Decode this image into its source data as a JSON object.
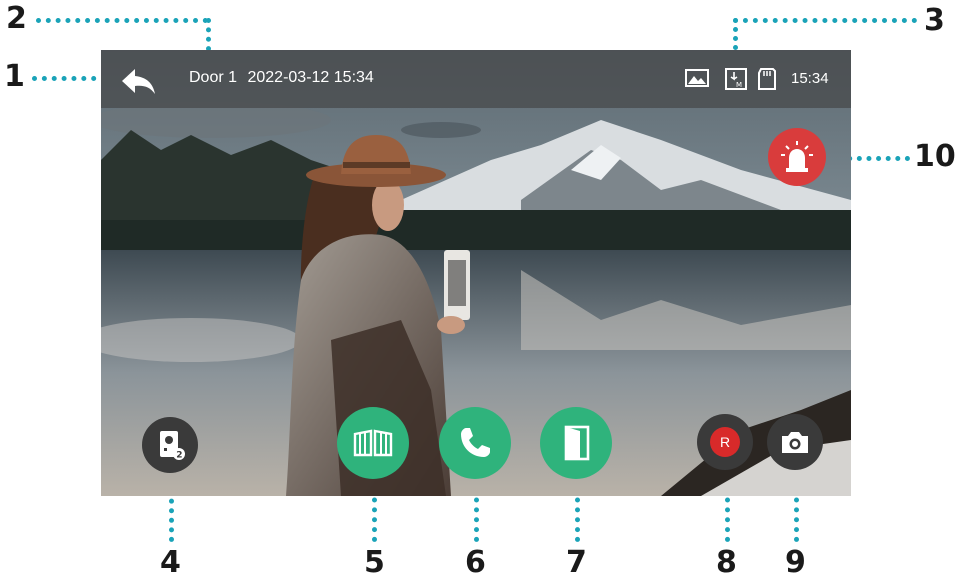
{
  "top_bar": {
    "door_label": "Door 1",
    "datetime": "2022-03-12 15:34",
    "time": "15:34",
    "status_icons": [
      "image-icon",
      "motion-icon",
      "sd-card-icon"
    ]
  },
  "buttons": {
    "back": "back-arrow-icon",
    "monitor_switch": "door-station-2-icon",
    "gate": "gate-icon",
    "call": "phone-icon",
    "door": "door-icon",
    "record_label": "R",
    "snapshot": "camera-icon",
    "alarm": "alarm-icon"
  },
  "callouts": [
    "1",
    "2",
    "3",
    "4",
    "5",
    "6",
    "7",
    "8",
    "9",
    "10"
  ],
  "colors": {
    "callout_line": "#1aa3b8",
    "green_button": "#2fb37c",
    "dark_button": "#3a3a3a",
    "alarm_button": "#d93c3c",
    "record_red": "#d82a2a"
  }
}
